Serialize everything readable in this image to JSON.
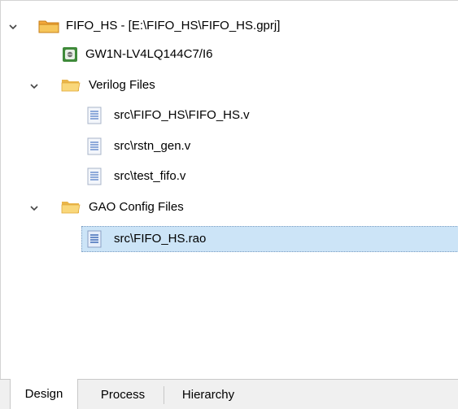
{
  "tree": {
    "project": {
      "label": "FIFO_HS - [E:\\FIFO_HS\\FIFO_HS.gprj]",
      "icon": "project-folder-icon"
    },
    "device": {
      "label": "GW1N-LV4LQ144C7/I6",
      "icon": "chip-icon"
    },
    "verilog_folder": {
      "label": "Verilog Files",
      "icon": "folder-icon"
    },
    "verilog_files": [
      {
        "label": "src\\FIFO_HS\\FIFO_HS.v"
      },
      {
        "label": "src\\rstn_gen.v"
      },
      {
        "label": "src\\test_fifo.v"
      }
    ],
    "gao_folder": {
      "label": "GAO Config Files",
      "icon": "folder-icon"
    },
    "gao_files": [
      {
        "label": "src\\FIFO_HS.rao",
        "selected": true
      }
    ]
  },
  "tabs": [
    {
      "label": "Design",
      "active": true
    },
    {
      "label": "Process",
      "active": false
    },
    {
      "label": "Hierarchy",
      "active": false
    }
  ],
  "colors": {
    "selection": "#cce4f7",
    "folder": "#f6c65b",
    "project_folder": "#f3a93c",
    "chip": "#3f8a3a",
    "file": "#4a78c4"
  }
}
